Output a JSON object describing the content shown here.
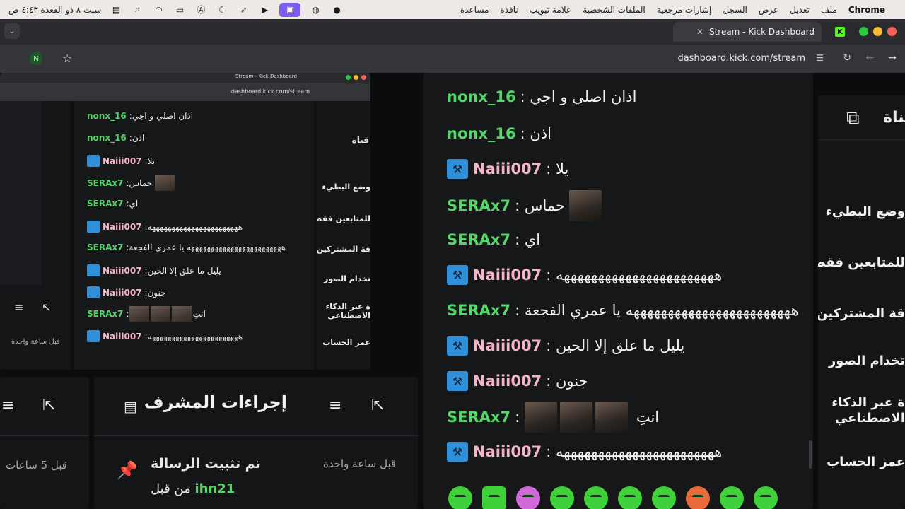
{
  "menubar": {
    "apple": "",
    "app": "Chrome",
    "items": [
      "ملف",
      "تعديل",
      "عرض",
      "السجل",
      "إشارات مرجعية",
      "الملفات الشخصية",
      "علامة تبويب",
      "نافذة",
      "مساعدة"
    ],
    "clock": "سبت ٨ ذو القعدة ٤:٤٣ ص"
  },
  "tab": {
    "title": "Stream - Kick Dashboard",
    "logo": "K",
    "new_tab": "+",
    "close": "✕"
  },
  "toolbar": {
    "url": "dashboard.kick.com/stream",
    "profile_initial": "N"
  },
  "colors": {
    "green_user": "#53d769",
    "pink_user": "#f5b5c8",
    "accent": "#53fc18"
  },
  "chat": {
    "messages": [
      {
        "user": "nonx_16",
        "text": "اذان اصلي و اجي",
        "color": "green",
        "badge": false
      },
      {
        "user": "nonx_16",
        "text": "اذن",
        "color": "green",
        "badge": false
      },
      {
        "user": "Naiii007",
        "text": "يلا",
        "color": "pink",
        "badge": true
      },
      {
        "user": "SERAx7",
        "text": "حماس",
        "color": "green",
        "badge": false,
        "thumbs": 1
      },
      {
        "user": "SERAx7",
        "text": "اي",
        "color": "green",
        "badge": false
      },
      {
        "user": "Naiii007",
        "text": "هههههههههههههههههههههههه",
        "color": "pink",
        "badge": true
      },
      {
        "user": "SERAx7",
        "text": "ههههههههههههههههههههههههه يا عمري الفجعة",
        "color": "green",
        "badge": false
      },
      {
        "user": "Naiii007",
        "text": "يليل ما علق إلا الحين",
        "color": "pink",
        "badge": true
      },
      {
        "user": "Naiii007",
        "text": "جنون",
        "color": "pink",
        "badge": true
      },
      {
        "user": "SERAx7",
        "text": "انتِ",
        "color": "green",
        "badge": false,
        "thumbs": 3
      },
      {
        "user": "Naiii007",
        "text": "هههههههههههههههههههههههه",
        "color": "pink",
        "badge": true
      }
    ]
  },
  "side_menu": {
    "header": "قناة",
    "items": [
      "وضع البطيء",
      "للمتابعين فقط",
      "قة المشتركين",
      "تخدام الصور",
      "ة عبر الذكاء الاصطناعي",
      "عمر الحساب"
    ]
  },
  "mod_panel": {
    "title": "إجراءات المشرف",
    "pinned": "تم تثبيت الرسالة",
    "by_prefix": "من قبل",
    "by_user": "ihn21",
    "time": "قبل ساعة واحدة"
  },
  "left_panel": {
    "time": "قبل 5 ساعات"
  },
  "mini": {
    "url": "dashboard.kick.com/stream",
    "tab": "Stream - Kick Dashboard",
    "time": "قبل ساعة واحدة"
  }
}
